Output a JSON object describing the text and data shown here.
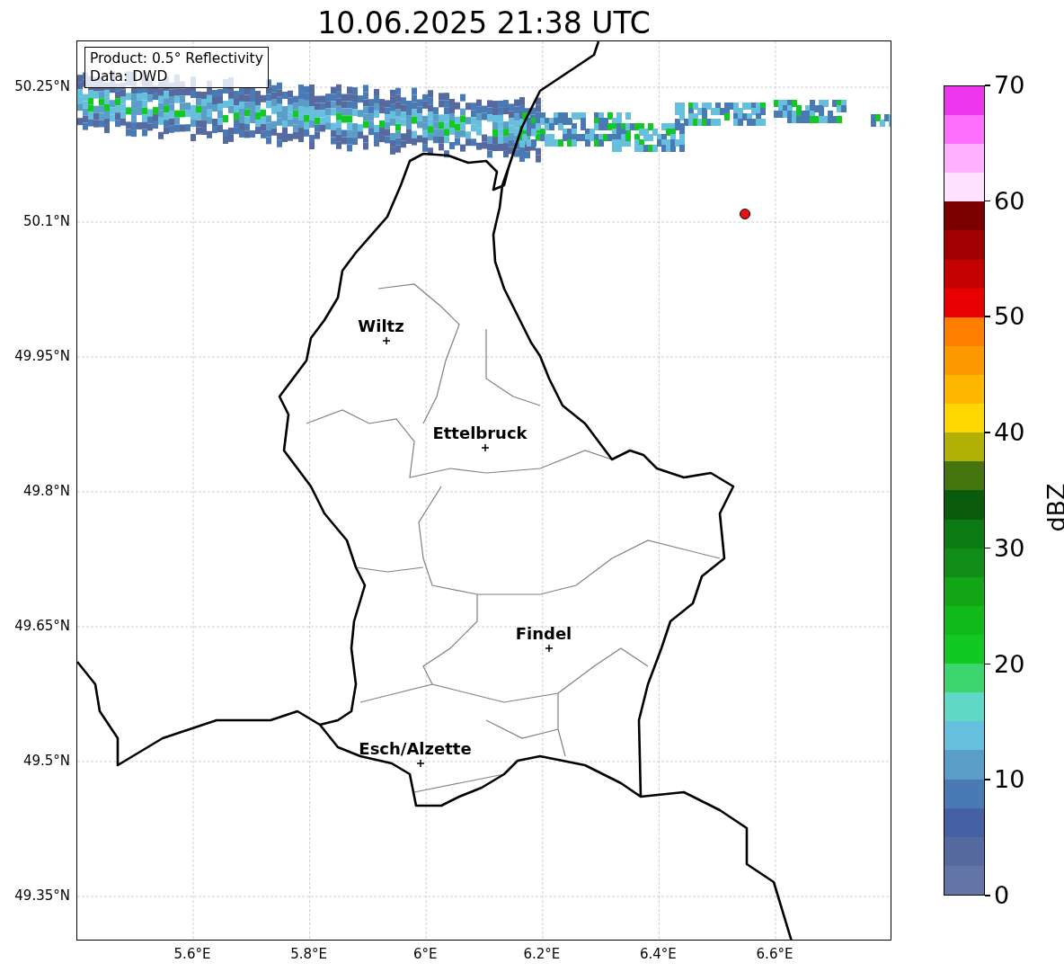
{
  "title": "10.06.2025 21:38 UTC",
  "legend": [
    "Product: 0.5° Reflectivity",
    "Data: DWD"
  ],
  "lat_ticks": [
    "50.25°N",
    "50.1°N",
    "49.95°N",
    "49.8°N",
    "49.65°N",
    "49.5°N",
    "49.35°N"
  ],
  "lon_ticks": [
    "5.6°E",
    "5.8°E",
    "6°E",
    "6.2°E",
    "6.4°E",
    "6.6°E"
  ],
  "cities": [
    {
      "name": "Wiltz"
    },
    {
      "name": "Ettelbruck"
    },
    {
      "name": "Findel"
    },
    {
      "name": "Esch/Alzette"
    }
  ],
  "colorbar": {
    "label": "dBZ",
    "ticks": [
      "70",
      "60",
      "50",
      "40",
      "30",
      "20",
      "10",
      "0"
    ]
  }
}
